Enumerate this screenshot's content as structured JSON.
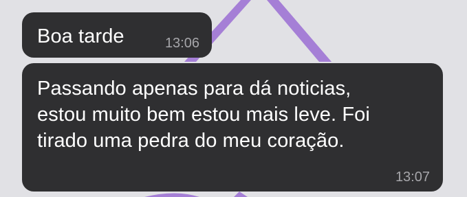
{
  "colors": {
    "background": "#e1e1e5",
    "bubble": "#2f2f31",
    "text": "#ffffff",
    "timestamp": "#a6a6aa",
    "wallpaper_accent": "#a57fd6"
  },
  "messages": [
    {
      "text": "Boa tarde",
      "time": "13:06"
    },
    {
      "text": "Passando apenas para dá noticias,\nestou muito bem estou mais leve. Foi\ntirado uma pedra do meu coração.",
      "time": "13:07"
    }
  ]
}
